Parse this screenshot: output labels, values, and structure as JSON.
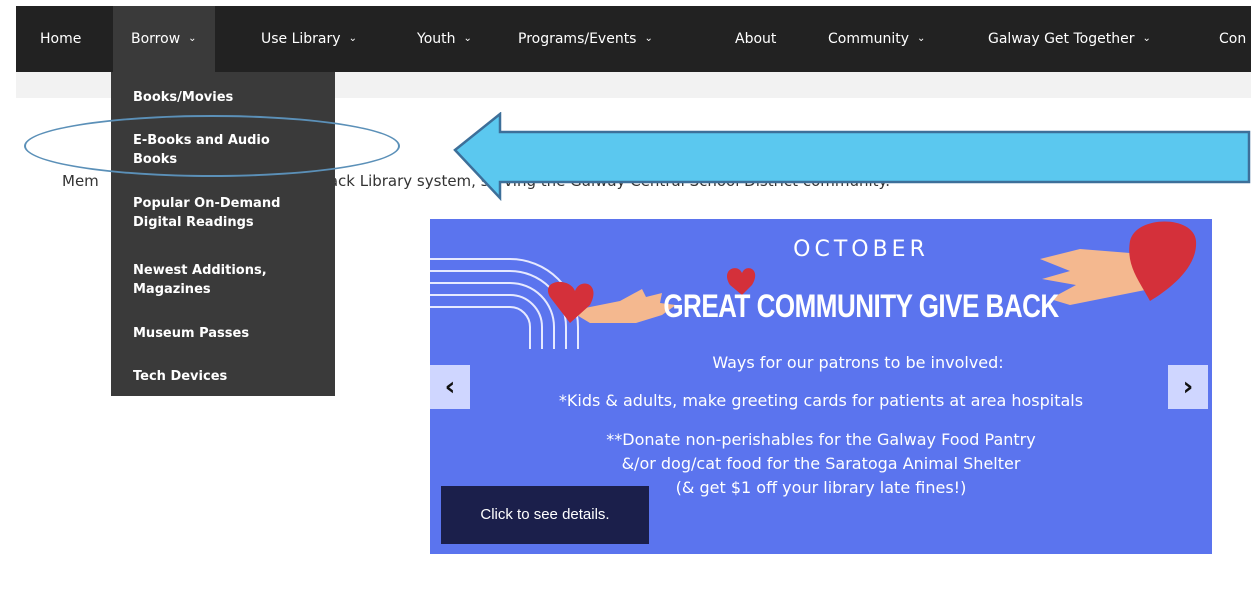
{
  "nav": {
    "items": [
      {
        "label": "Home",
        "has_dropdown": false
      },
      {
        "label": "Borrow",
        "has_dropdown": true,
        "active": true
      },
      {
        "label": "Use Library",
        "has_dropdown": true
      },
      {
        "label": "Youth",
        "has_dropdown": true
      },
      {
        "label": "Programs/Events",
        "has_dropdown": true
      },
      {
        "label": "About",
        "has_dropdown": false
      },
      {
        "label": "Community",
        "has_dropdown": true
      },
      {
        "label": "Galway Get Together",
        "has_dropdown": true
      },
      {
        "label": "Con",
        "has_dropdown": false
      }
    ],
    "chevron": "⌄"
  },
  "dropdown": {
    "items": [
      "Books/Movies",
      "E-Books and Audio Books",
      "Popular On-Demand Digital Readings",
      "Newest Additions, Magazines",
      "Museum Passes",
      "Tech Devices"
    ],
    "highlighted_index": 1
  },
  "tagline": {
    "visible_start": "Mem",
    "visible_end": "ndack Library system, serving the Galway Central School District community."
  },
  "banner": {
    "month": "OCTOBER",
    "headline": "GREAT COMMUNITY GIVE BACK",
    "lines": [
      "Ways for our patrons to be involved:",
      "*Kids & adults, make greeting cards for patients at area hospitals",
      "**Donate non-perishables for the Galway Food Pantry",
      "&/or dog/cat food for the Saratoga Animal Shelter",
      "(& get $1 off your library late fines!)"
    ],
    "details_button": "Click to see details.",
    "prev_icon": "‹",
    "next_icon": "›"
  },
  "colors": {
    "navbar": "#222222",
    "dropdown": "#3a3a3a",
    "banner": "#5b74ee",
    "arrow_fill": "#5bc8ef",
    "arrow_stroke": "#3d6f99",
    "details_button": "#1b1f4b"
  }
}
